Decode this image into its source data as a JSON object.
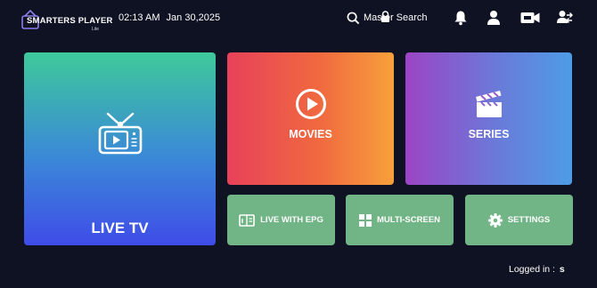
{
  "header": {
    "logo_name": "SMARTERS PLAYER",
    "logo_sub": "Lite",
    "time": "02:13 AM",
    "date": "Jan 30,2025",
    "search_label": "Master Search",
    "icons": [
      "search-icon",
      "lock-icon",
      "bell-icon",
      "user-icon",
      "video-camera-icon",
      "switch-user-icon"
    ]
  },
  "tiles": {
    "live": {
      "label": "LIVE TV",
      "icon": "tv-icon"
    },
    "movies": {
      "label": "MOVIES",
      "icon": "play-circle-icon"
    },
    "series": {
      "label": "SERIES",
      "icon": "clapperboard-icon"
    },
    "epg": {
      "label": "LIVE WITH EPG",
      "icon": "epg-book-icon"
    },
    "multi": {
      "label": "MULTI-SCREEN",
      "icon": "grid-icon"
    },
    "settings": {
      "label": "SETTINGS",
      "icon": "gear-icon"
    }
  },
  "footer": {
    "logged_in_label": "Logged in :",
    "username": "s"
  },
  "colors": {
    "background": "#0f1222",
    "small_tile": "#71b485"
  }
}
